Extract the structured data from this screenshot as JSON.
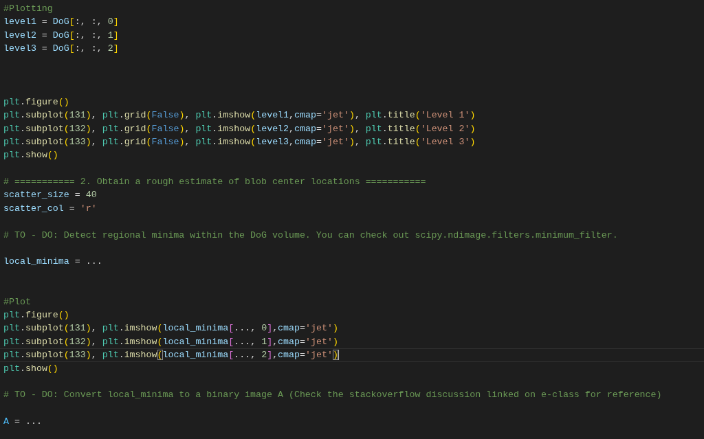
{
  "editor": {
    "lines": [
      {
        "current": false,
        "tokens": [
          {
            "kind": "comment",
            "text": "#Plotting"
          }
        ]
      },
      {
        "current": false,
        "tokens": [
          {
            "kind": "var",
            "text": "level1"
          },
          {
            "kind": "plain",
            "text": " = "
          },
          {
            "kind": "var",
            "text": "DoG"
          },
          {
            "kind": "bracket1",
            "text": "["
          },
          {
            "kind": "plain",
            "text": ":, :, "
          },
          {
            "kind": "number",
            "text": "0"
          },
          {
            "kind": "bracket1",
            "text": "]"
          }
        ]
      },
      {
        "current": false,
        "tokens": [
          {
            "kind": "var",
            "text": "level2"
          },
          {
            "kind": "plain",
            "text": " = "
          },
          {
            "kind": "var",
            "text": "DoG"
          },
          {
            "kind": "bracket1",
            "text": "["
          },
          {
            "kind": "plain",
            "text": ":, :, "
          },
          {
            "kind": "number",
            "text": "1"
          },
          {
            "kind": "bracket1",
            "text": "]"
          }
        ]
      },
      {
        "current": false,
        "tokens": [
          {
            "kind": "var",
            "text": "level3"
          },
          {
            "kind": "plain",
            "text": " = "
          },
          {
            "kind": "var",
            "text": "DoG"
          },
          {
            "kind": "bracket1",
            "text": "["
          },
          {
            "kind": "plain",
            "text": ":, :, "
          },
          {
            "kind": "number",
            "text": "2"
          },
          {
            "kind": "bracket1",
            "text": "]"
          }
        ]
      },
      {
        "current": false
      },
      {
        "current": false
      },
      {
        "current": false
      },
      {
        "current": false,
        "tokens": [
          {
            "kind": "class",
            "text": "plt"
          },
          {
            "kind": "plain",
            "text": "."
          },
          {
            "kind": "func",
            "text": "figure"
          },
          {
            "kind": "bracket1",
            "text": "()"
          }
        ]
      },
      {
        "current": false,
        "tokens": [
          {
            "kind": "class",
            "text": "plt"
          },
          {
            "kind": "plain",
            "text": "."
          },
          {
            "kind": "func",
            "text": "subplot"
          },
          {
            "kind": "bracket1",
            "text": "("
          },
          {
            "kind": "number",
            "text": "131"
          },
          {
            "kind": "bracket1",
            "text": ")"
          },
          {
            "kind": "plain",
            "text": ", "
          },
          {
            "kind": "class",
            "text": "plt"
          },
          {
            "kind": "plain",
            "text": "."
          },
          {
            "kind": "func",
            "text": "grid"
          },
          {
            "kind": "bracket1",
            "text": "("
          },
          {
            "kind": "keyword",
            "text": "False"
          },
          {
            "kind": "bracket1",
            "text": ")"
          },
          {
            "kind": "plain",
            "text": ", "
          },
          {
            "kind": "class",
            "text": "plt"
          },
          {
            "kind": "plain",
            "text": "."
          },
          {
            "kind": "func",
            "text": "imshow"
          },
          {
            "kind": "bracket1",
            "text": "("
          },
          {
            "kind": "var",
            "text": "level1"
          },
          {
            "kind": "plain",
            "text": ","
          },
          {
            "kind": "var",
            "text": "cmap"
          },
          {
            "kind": "plain",
            "text": "="
          },
          {
            "kind": "string",
            "text": "'jet'"
          },
          {
            "kind": "bracket1",
            "text": ")"
          },
          {
            "kind": "plain",
            "text": ", "
          },
          {
            "kind": "class",
            "text": "plt"
          },
          {
            "kind": "plain",
            "text": "."
          },
          {
            "kind": "func",
            "text": "title"
          },
          {
            "kind": "bracket1",
            "text": "("
          },
          {
            "kind": "string",
            "text": "'Level 1'"
          },
          {
            "kind": "bracket1",
            "text": ")"
          }
        ]
      },
      {
        "current": false,
        "tokens": [
          {
            "kind": "class",
            "text": "plt"
          },
          {
            "kind": "plain",
            "text": "."
          },
          {
            "kind": "func",
            "text": "subplot"
          },
          {
            "kind": "bracket1",
            "text": "("
          },
          {
            "kind": "number",
            "text": "132"
          },
          {
            "kind": "bracket1",
            "text": ")"
          },
          {
            "kind": "plain",
            "text": ", "
          },
          {
            "kind": "class",
            "text": "plt"
          },
          {
            "kind": "plain",
            "text": "."
          },
          {
            "kind": "func",
            "text": "grid"
          },
          {
            "kind": "bracket1",
            "text": "("
          },
          {
            "kind": "keyword",
            "text": "False"
          },
          {
            "kind": "bracket1",
            "text": ")"
          },
          {
            "kind": "plain",
            "text": ", "
          },
          {
            "kind": "class",
            "text": "plt"
          },
          {
            "kind": "plain",
            "text": "."
          },
          {
            "kind": "func",
            "text": "imshow"
          },
          {
            "kind": "bracket1",
            "text": "("
          },
          {
            "kind": "var",
            "text": "level2"
          },
          {
            "kind": "plain",
            "text": ","
          },
          {
            "kind": "var",
            "text": "cmap"
          },
          {
            "kind": "plain",
            "text": "="
          },
          {
            "kind": "string",
            "text": "'jet'"
          },
          {
            "kind": "bracket1",
            "text": ")"
          },
          {
            "kind": "plain",
            "text": ", "
          },
          {
            "kind": "class",
            "text": "plt"
          },
          {
            "kind": "plain",
            "text": "."
          },
          {
            "kind": "func",
            "text": "title"
          },
          {
            "kind": "bracket1",
            "text": "("
          },
          {
            "kind": "string",
            "text": "'Level 2'"
          },
          {
            "kind": "bracket1",
            "text": ")"
          }
        ]
      },
      {
        "current": false,
        "tokens": [
          {
            "kind": "class",
            "text": "plt"
          },
          {
            "kind": "plain",
            "text": "."
          },
          {
            "kind": "func",
            "text": "subplot"
          },
          {
            "kind": "bracket1",
            "text": "("
          },
          {
            "kind": "number",
            "text": "133"
          },
          {
            "kind": "bracket1",
            "text": ")"
          },
          {
            "kind": "plain",
            "text": ", "
          },
          {
            "kind": "class",
            "text": "plt"
          },
          {
            "kind": "plain",
            "text": "."
          },
          {
            "kind": "func",
            "text": "grid"
          },
          {
            "kind": "bracket1",
            "text": "("
          },
          {
            "kind": "keyword",
            "text": "False"
          },
          {
            "kind": "bracket1",
            "text": ")"
          },
          {
            "kind": "plain",
            "text": ", "
          },
          {
            "kind": "class",
            "text": "plt"
          },
          {
            "kind": "plain",
            "text": "."
          },
          {
            "kind": "func",
            "text": "imshow"
          },
          {
            "kind": "bracket1",
            "text": "("
          },
          {
            "kind": "var",
            "text": "level3"
          },
          {
            "kind": "plain",
            "text": ","
          },
          {
            "kind": "var",
            "text": "cmap"
          },
          {
            "kind": "plain",
            "text": "="
          },
          {
            "kind": "string",
            "text": "'jet'"
          },
          {
            "kind": "bracket1",
            "text": ")"
          },
          {
            "kind": "plain",
            "text": ", "
          },
          {
            "kind": "class",
            "text": "plt"
          },
          {
            "kind": "plain",
            "text": "."
          },
          {
            "kind": "func",
            "text": "title"
          },
          {
            "kind": "bracket1",
            "text": "("
          },
          {
            "kind": "string",
            "text": "'Level 3'"
          },
          {
            "kind": "bracket1",
            "text": ")"
          }
        ]
      },
      {
        "current": false,
        "tokens": [
          {
            "kind": "class",
            "text": "plt"
          },
          {
            "kind": "plain",
            "text": "."
          },
          {
            "kind": "func",
            "text": "show"
          },
          {
            "kind": "bracket1",
            "text": "()"
          }
        ]
      },
      {
        "current": false
      },
      {
        "current": false,
        "tokens": [
          {
            "kind": "comment",
            "text": "# =========== 2. Obtain a rough estimate of blob center locations ==========="
          }
        ]
      },
      {
        "current": false,
        "tokens": [
          {
            "kind": "var",
            "text": "scatter_size"
          },
          {
            "kind": "plain",
            "text": " = "
          },
          {
            "kind": "number",
            "text": "40"
          }
        ]
      },
      {
        "current": false,
        "tokens": [
          {
            "kind": "var",
            "text": "scatter_col"
          },
          {
            "kind": "plain",
            "text": " = "
          },
          {
            "kind": "string",
            "text": "'r'"
          }
        ]
      },
      {
        "current": false
      },
      {
        "current": false,
        "tokens": [
          {
            "kind": "comment",
            "text": "# TO - DO: Detect regional minima within the DoG volume. You can check out scipy.ndimage.filters.minimum_filter."
          }
        ]
      },
      {
        "current": false
      },
      {
        "current": false,
        "tokens": [
          {
            "kind": "var",
            "text": "local_minima"
          },
          {
            "kind": "plain",
            "text": " = ..."
          }
        ]
      },
      {
        "current": false
      },
      {
        "current": false
      },
      {
        "current": false,
        "tokens": [
          {
            "kind": "comment",
            "text": "#Plot"
          }
        ]
      },
      {
        "current": false,
        "tokens": [
          {
            "kind": "class",
            "text": "plt"
          },
          {
            "kind": "plain",
            "text": "."
          },
          {
            "kind": "func",
            "text": "figure"
          },
          {
            "kind": "bracket1",
            "text": "()"
          }
        ]
      },
      {
        "current": false,
        "tokens": [
          {
            "kind": "class",
            "text": "plt"
          },
          {
            "kind": "plain",
            "text": "."
          },
          {
            "kind": "func",
            "text": "subplot"
          },
          {
            "kind": "bracket1",
            "text": "("
          },
          {
            "kind": "number",
            "text": "131"
          },
          {
            "kind": "bracket1",
            "text": ")"
          },
          {
            "kind": "plain",
            "text": ", "
          },
          {
            "kind": "class",
            "text": "plt"
          },
          {
            "kind": "plain",
            "text": "."
          },
          {
            "kind": "func",
            "text": "imshow"
          },
          {
            "kind": "bracket1",
            "text": "("
          },
          {
            "kind": "var",
            "text": "local_minima"
          },
          {
            "kind": "bracket2",
            "text": "["
          },
          {
            "kind": "plain",
            "text": "..., "
          },
          {
            "kind": "number",
            "text": "0"
          },
          {
            "kind": "bracket2",
            "text": "]"
          },
          {
            "kind": "plain",
            "text": ","
          },
          {
            "kind": "var",
            "text": "cmap"
          },
          {
            "kind": "plain",
            "text": "="
          },
          {
            "kind": "string",
            "text": "'jet'"
          },
          {
            "kind": "bracket1",
            "text": ")"
          }
        ]
      },
      {
        "current": false,
        "tokens": [
          {
            "kind": "class",
            "text": "plt"
          },
          {
            "kind": "plain",
            "text": "."
          },
          {
            "kind": "func",
            "text": "subplot"
          },
          {
            "kind": "bracket1",
            "text": "("
          },
          {
            "kind": "number",
            "text": "132"
          },
          {
            "kind": "bracket1",
            "text": ")"
          },
          {
            "kind": "plain",
            "text": ", "
          },
          {
            "kind": "class",
            "text": "plt"
          },
          {
            "kind": "plain",
            "text": "."
          },
          {
            "kind": "func",
            "text": "imshow"
          },
          {
            "kind": "bracket1",
            "text": "("
          },
          {
            "kind": "var",
            "text": "local_minima"
          },
          {
            "kind": "bracket2",
            "text": "["
          },
          {
            "kind": "plain",
            "text": "..., "
          },
          {
            "kind": "number",
            "text": "1"
          },
          {
            "kind": "bracket2",
            "text": "]"
          },
          {
            "kind": "plain",
            "text": ","
          },
          {
            "kind": "var",
            "text": "cmap"
          },
          {
            "kind": "plain",
            "text": "="
          },
          {
            "kind": "string",
            "text": "'jet'"
          },
          {
            "kind": "bracket1",
            "text": ")"
          }
        ]
      },
      {
        "current": true,
        "tokens": [
          {
            "kind": "class",
            "text": "plt"
          },
          {
            "kind": "plain",
            "text": "."
          },
          {
            "kind": "func",
            "text": "subplot"
          },
          {
            "kind": "bracket1",
            "text": "("
          },
          {
            "kind": "number",
            "text": "133"
          },
          {
            "kind": "bracket1",
            "text": ")"
          },
          {
            "kind": "plain",
            "text": ", "
          },
          {
            "kind": "class",
            "text": "plt"
          },
          {
            "kind": "plain",
            "text": "."
          },
          {
            "kind": "func",
            "text": "imshow"
          },
          {
            "kind": "bracket1-matched",
            "text": "("
          },
          {
            "kind": "var",
            "text": "local_minima"
          },
          {
            "kind": "bracket2",
            "text": "["
          },
          {
            "kind": "plain",
            "text": "..., "
          },
          {
            "kind": "number",
            "text": "2"
          },
          {
            "kind": "bracket2",
            "text": "]"
          },
          {
            "kind": "plain",
            "text": ","
          },
          {
            "kind": "var",
            "text": "cmap"
          },
          {
            "kind": "plain",
            "text": "="
          },
          {
            "kind": "string",
            "text": "'jet'"
          },
          {
            "kind": "bracket1-matched",
            "text": ")"
          }
        ]
      },
      {
        "current": false,
        "tokens": [
          {
            "kind": "class",
            "text": "plt"
          },
          {
            "kind": "plain",
            "text": "."
          },
          {
            "kind": "func",
            "text": "show"
          },
          {
            "kind": "bracket1",
            "text": "()"
          }
        ]
      },
      {
        "current": false
      },
      {
        "current": false,
        "tokens": [
          {
            "kind": "comment",
            "text": "# TO - DO: Convert local_minima to a binary image A (Check the stackoverflow discussion linked on e-class for reference)"
          }
        ]
      },
      {
        "current": false
      },
      {
        "current": false,
        "tokens": [
          {
            "kind": "constant",
            "text": "A"
          },
          {
            "kind": "plain",
            "text": " = ..."
          }
        ]
      }
    ]
  }
}
